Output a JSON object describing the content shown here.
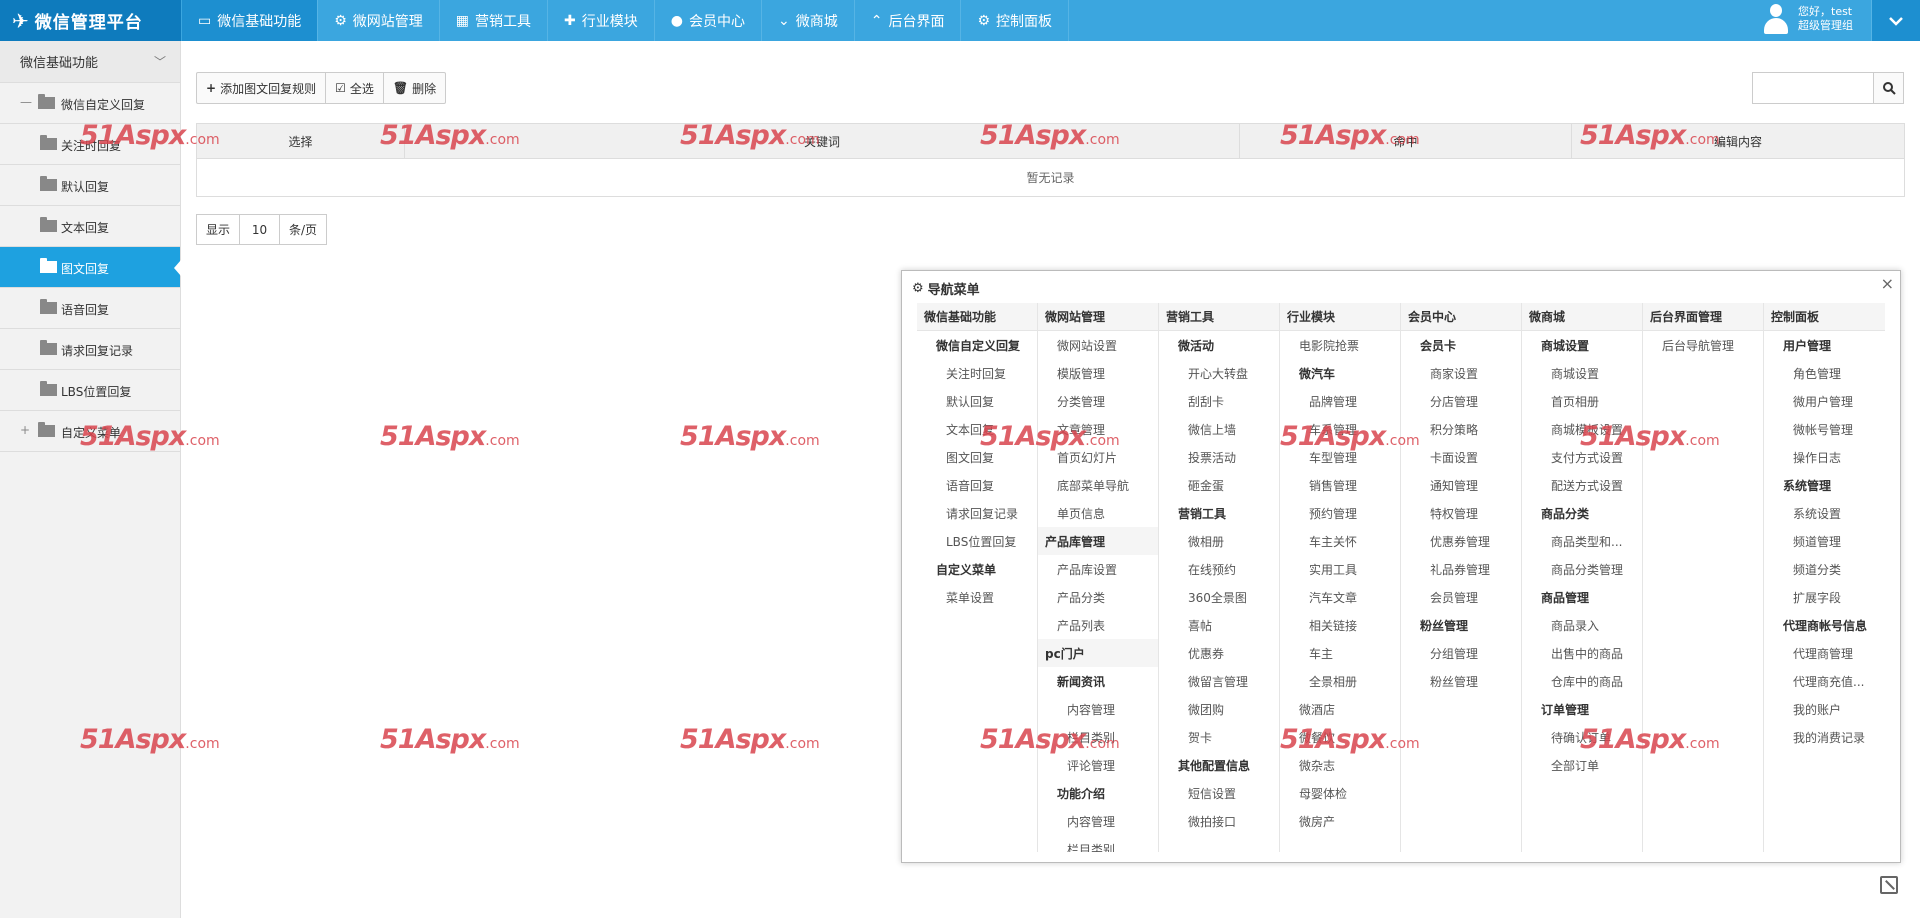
{
  "header": {
    "logo_text": "微信管理平台",
    "nav": [
      {
        "label": "微信基础功能",
        "icon": "monitor-icon",
        "active": true
      },
      {
        "label": "微网站管理",
        "icon": "gear-icon",
        "active": false
      },
      {
        "label": "营销工具",
        "icon": "bank-icon",
        "active": false
      },
      {
        "label": "行业模块",
        "icon": "puzzle-icon",
        "active": false
      },
      {
        "label": "会员中心",
        "icon": "user-icon",
        "active": false
      },
      {
        "label": "微商城",
        "icon": "chevron-down-icon",
        "active": false
      },
      {
        "label": "后台界面",
        "icon": "chevron-up-icon",
        "active": false
      },
      {
        "label": "控制面板",
        "icon": "gear-icon",
        "active": false
      }
    ],
    "user": {
      "greeting": "您好，test",
      "role": "超级管理组"
    }
  },
  "sidebar": {
    "title": "微信基础功能",
    "items": [
      {
        "label": "微信自定义回复",
        "level": 0,
        "marker": "—"
      },
      {
        "label": "关注时回复",
        "level": 1,
        "marker": ""
      },
      {
        "label": "默认回复",
        "level": 1,
        "marker": ""
      },
      {
        "label": "文本回复",
        "level": 1,
        "marker": ""
      },
      {
        "label": "图文回复",
        "level": 1,
        "marker": "",
        "active": true
      },
      {
        "label": "语音回复",
        "level": 1,
        "marker": ""
      },
      {
        "label": "请求回复记录",
        "level": 1,
        "marker": ""
      },
      {
        "label": "LBS位置回复",
        "level": 1,
        "marker": ""
      },
      {
        "label": "自定义菜单",
        "level": 0,
        "marker": "+"
      }
    ]
  },
  "toolbar": {
    "add_label": "添加图文回复规则",
    "select_all_label": "全选",
    "delete_label": "删除"
  },
  "search": {
    "placeholder": ""
  },
  "table": {
    "headers": [
      "选择",
      "关键词",
      "命中",
      "编辑内容"
    ],
    "empty_text": "暂无记录"
  },
  "pager": {
    "show_label": "显示",
    "page_size": "10",
    "unit_label": "条/页"
  },
  "nav_panel": {
    "title": "导航菜单",
    "columns": [
      {
        "header": "微信基础功能",
        "items": [
          {
            "t": "微信自定义回复",
            "c": "l1"
          },
          {
            "t": "关注时回复",
            "c": "l2"
          },
          {
            "t": "默认回复",
            "c": "l2"
          },
          {
            "t": "文本回复",
            "c": "l2"
          },
          {
            "t": "图文回复",
            "c": "l2"
          },
          {
            "t": "语音回复",
            "c": "l2"
          },
          {
            "t": "请求回复记录",
            "c": "l2"
          },
          {
            "t": "LBS位置回复",
            "c": "l2"
          },
          {
            "t": "自定义菜单",
            "c": "l1"
          },
          {
            "t": "菜单设置",
            "c": "l2"
          }
        ]
      },
      {
        "header": "微网站管理",
        "items": [
          {
            "t": "微网站设置",
            "c": "l1n"
          },
          {
            "t": "模版管理",
            "c": "l1n"
          },
          {
            "t": "分类管理",
            "c": "l1n"
          },
          {
            "t": "文章管理",
            "c": "l1n"
          },
          {
            "t": "首页幻灯片",
            "c": "l1n"
          },
          {
            "t": "底部菜单导航",
            "c": "l1n"
          },
          {
            "t": "单页信息",
            "c": "l1n"
          },
          {
            "t": "产品库管理",
            "c": "l1b"
          },
          {
            "t": "产品库设置",
            "c": "l1n"
          },
          {
            "t": "产品分类",
            "c": "l1n"
          },
          {
            "t": "产品列表",
            "c": "l1n"
          },
          {
            "t": "pc门户",
            "c": "l1b"
          },
          {
            "t": "新闻资讯",
            "c": "l1"
          },
          {
            "t": "内容管理",
            "c": "l2"
          },
          {
            "t": "栏目类别",
            "c": "l2"
          },
          {
            "t": "评论管理",
            "c": "l2"
          },
          {
            "t": "功能介绍",
            "c": "l1"
          },
          {
            "t": "内容管理",
            "c": "l2"
          },
          {
            "t": "栏目类别",
            "c": "l2"
          }
        ]
      },
      {
        "header": "营销工具",
        "items": [
          {
            "t": "微活动",
            "c": "l1"
          },
          {
            "t": "开心大转盘",
            "c": "l2"
          },
          {
            "t": "刮刮卡",
            "c": "l2"
          },
          {
            "t": "微信上墙",
            "c": "l2"
          },
          {
            "t": "投票活动",
            "c": "l2"
          },
          {
            "t": "砸金蛋",
            "c": "l2"
          },
          {
            "t": "营销工具",
            "c": "l1"
          },
          {
            "t": "微相册",
            "c": "l2"
          },
          {
            "t": "在线预约",
            "c": "l2"
          },
          {
            "t": "360全景图",
            "c": "l2"
          },
          {
            "t": "喜帖",
            "c": "l2"
          },
          {
            "t": "优惠券",
            "c": "l2"
          },
          {
            "t": "微留言管理",
            "c": "l2"
          },
          {
            "t": "微团购",
            "c": "l2"
          },
          {
            "t": "贺卡",
            "c": "l2"
          },
          {
            "t": "其他配置信息",
            "c": "l1"
          },
          {
            "t": "短信设置",
            "c": "l2"
          },
          {
            "t": "微拍接口",
            "c": "l2"
          }
        ]
      },
      {
        "header": "行业模块",
        "items": [
          {
            "t": "电影院抢票",
            "c": "l1n"
          },
          {
            "t": "微汽车",
            "c": "l1"
          },
          {
            "t": "品牌管理",
            "c": "l2"
          },
          {
            "t": "车系管理",
            "c": "l2"
          },
          {
            "t": "车型管理",
            "c": "l2"
          },
          {
            "t": "销售管理",
            "c": "l2"
          },
          {
            "t": "预约管理",
            "c": "l2"
          },
          {
            "t": "车主关怀",
            "c": "l2"
          },
          {
            "t": "实用工具",
            "c": "l2"
          },
          {
            "t": "汽车文章",
            "c": "l2"
          },
          {
            "t": "相关链接",
            "c": "l2"
          },
          {
            "t": "车主",
            "c": "l2"
          },
          {
            "t": "全景相册",
            "c": "l2"
          },
          {
            "t": "微酒店",
            "c": "l1n"
          },
          {
            "t": "微餐饮",
            "c": "l1n"
          },
          {
            "t": "微杂志",
            "c": "l1n"
          },
          {
            "t": "母婴体检",
            "c": "l1n"
          },
          {
            "t": "微房产",
            "c": "l1n"
          }
        ]
      },
      {
        "header": "会员中心",
        "items": [
          {
            "t": "会员卡",
            "c": "l1"
          },
          {
            "t": "商家设置",
            "c": "l2"
          },
          {
            "t": "分店管理",
            "c": "l2"
          },
          {
            "t": "积分策略",
            "c": "l2"
          },
          {
            "t": "卡面设置",
            "c": "l2"
          },
          {
            "t": "通知管理",
            "c": "l2"
          },
          {
            "t": "特权管理",
            "c": "l2"
          },
          {
            "t": "优惠券管理",
            "c": "l2"
          },
          {
            "t": "礼品券管理",
            "c": "l2"
          },
          {
            "t": "会员管理",
            "c": "l2"
          },
          {
            "t": "粉丝管理",
            "c": "l1"
          },
          {
            "t": "分组管理",
            "c": "l2"
          },
          {
            "t": "粉丝管理",
            "c": "l2"
          }
        ]
      },
      {
        "header": "微商城",
        "items": [
          {
            "t": "商城设置",
            "c": "l1"
          },
          {
            "t": "商城设置",
            "c": "l2"
          },
          {
            "t": "首页相册",
            "c": "l2"
          },
          {
            "t": "商城模板设置",
            "c": "l2"
          },
          {
            "t": "支付方式设置",
            "c": "l2"
          },
          {
            "t": "配送方式设置",
            "c": "l2"
          },
          {
            "t": "商品分类",
            "c": "l1"
          },
          {
            "t": "商品类型和...",
            "c": "l2"
          },
          {
            "t": "商品分类管理",
            "c": "l2"
          },
          {
            "t": "商品管理",
            "c": "l1"
          },
          {
            "t": "商品录入",
            "c": "l2"
          },
          {
            "t": "出售中的商品",
            "c": "l2"
          },
          {
            "t": "仓库中的商品",
            "c": "l2"
          },
          {
            "t": "订单管理",
            "c": "l1"
          },
          {
            "t": "待确认订单",
            "c": "l2"
          },
          {
            "t": "全部订单",
            "c": "l2"
          }
        ]
      },
      {
        "header": "后台界面管理",
        "items": [
          {
            "t": "后台导航管理",
            "c": "l1n"
          }
        ]
      },
      {
        "header": "控制面板",
        "items": [
          {
            "t": "用户管理",
            "c": "l1"
          },
          {
            "t": "角色管理",
            "c": "l2"
          },
          {
            "t": "微用户管理",
            "c": "l2"
          },
          {
            "t": "微帐号管理",
            "c": "l2"
          },
          {
            "t": "操作日志",
            "c": "l2"
          },
          {
            "t": "系统管理",
            "c": "l1"
          },
          {
            "t": "系统设置",
            "c": "l2"
          },
          {
            "t": "频道管理",
            "c": "l2"
          },
          {
            "t": "频道分类",
            "c": "l2"
          },
          {
            "t": "扩展字段",
            "c": "l2"
          },
          {
            "t": "代理商帐号信息",
            "c": "l1"
          },
          {
            "t": "代理商管理",
            "c": "l2"
          },
          {
            "t": "代理商充值...",
            "c": "l2"
          },
          {
            "t": "我的账户",
            "c": "l2"
          },
          {
            "t": "我的消费记录",
            "c": "l2"
          }
        ]
      }
    ]
  },
  "watermark": {
    "text": "51Aspx",
    "suffix": ".com"
  },
  "colors": {
    "topbar": "#3ba6df",
    "logo_bg": "#0e7bbd",
    "nav_active": "#1d8fd0",
    "sidebar_active": "#1ea1e0",
    "watermark": "#d9454e"
  }
}
